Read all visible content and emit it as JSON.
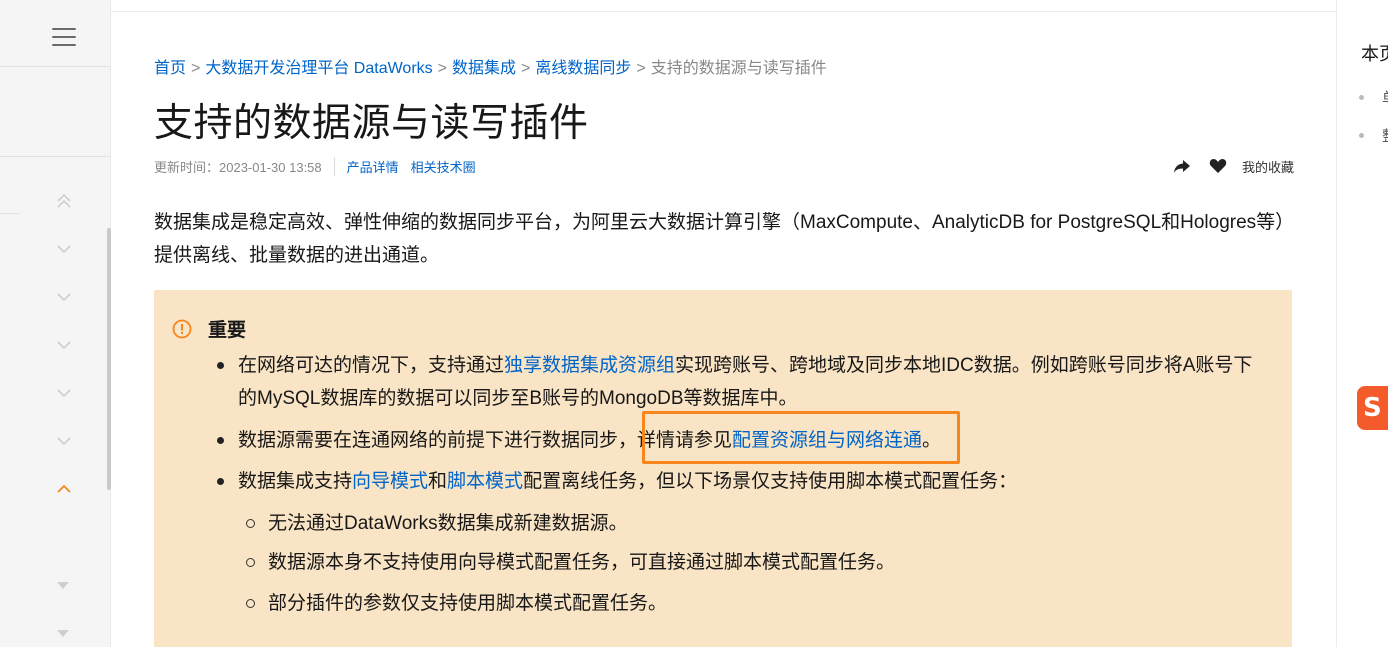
{
  "breadcrumb": {
    "items": [
      "首页",
      "大数据开发治理平台 DataWorks",
      "数据集成",
      "离线数据同步"
    ],
    "separator": ">",
    "current": "支持的数据源与读写插件"
  },
  "page_title": "支持的数据源与读写插件",
  "meta": {
    "updated": "更新时间：2023-01-30 13:58",
    "links": [
      "产品详情",
      "相关技术圈"
    ]
  },
  "actions": {
    "share_icon": "share-icon",
    "favorite_icon": "heart-icon",
    "favorites_label": "我的收藏"
  },
  "intro": {
    "text": "数据集成是稳定高效、弹性伸缩的数据同步平台，为阿里云大数据计算引擎（MaxCompute、AnalyticDB for PostgreSQL和Hologres等）提供离线、批量数据的进出通道。"
  },
  "notice": {
    "title": "重要",
    "bullet1": {
      "pre": "在网络可达的情况下，支持通过",
      "link": "独享数据集成资源组",
      "post_line1": "实现跨账号、跨地域及同步本地IDC数据。例如跨账号同步将A账号下",
      "line2": "的MySQL数据库的数据可以同步至B账号的MongoDB等数据库中。"
    },
    "bullet2": {
      "pre": "数据源需要在连通网络的前提下进行数据同步，详情请参见",
      "link": "配置资源组与网络连通",
      "post": "。"
    },
    "bullet3": {
      "pre": "数据集成支持",
      "link1": "向导模式",
      "mid": "和",
      "link2": "脚本模式",
      "post": "配置离线任务，但以下场景仅支持使用脚本模式配置任务：",
      "sub": [
        "无法通过DataWorks数据集成新建数据源。",
        "数据源本身不支持使用向导模式配置任务，可直接通过脚本模式配置任务。",
        "部分插件的参数仅支持使用脚本模式配置任务。"
      ]
    }
  },
  "right_panel": {
    "title": "本页",
    "items": [
      "单",
      "整"
    ]
  },
  "colors": {
    "link": "#0064c8",
    "notice_bg": "#f9e4c5",
    "warning": "#f7861d",
    "highlight": "#f7861d"
  }
}
